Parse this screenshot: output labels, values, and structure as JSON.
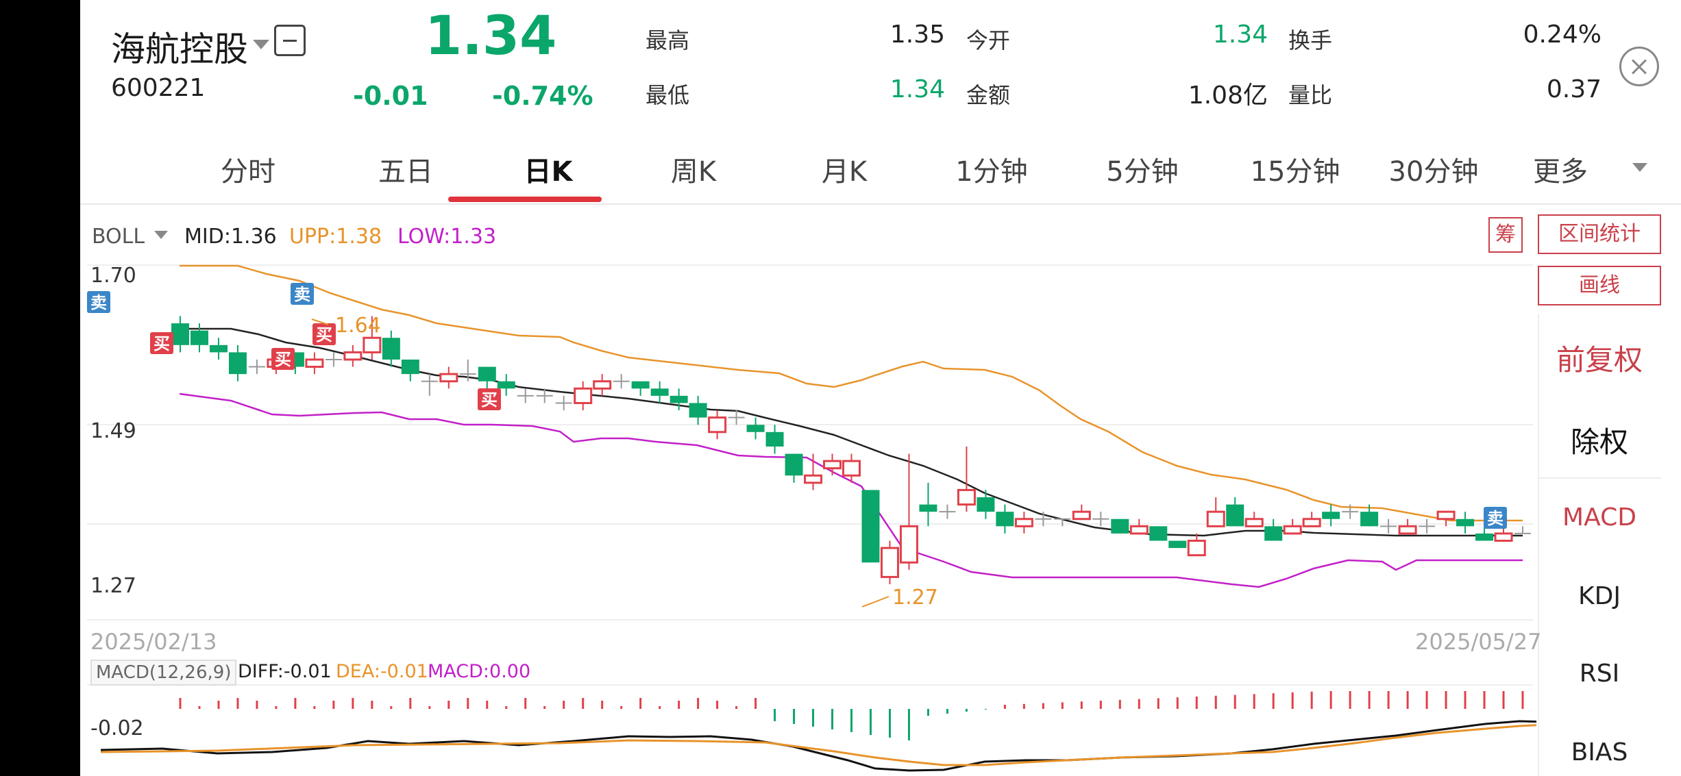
{
  "header": {
    "name": "海航控股",
    "code": "600221",
    "price": "1.34",
    "change": "-0.01",
    "change_pct": "-0.74%",
    "quotes": [
      {
        "label": "最高",
        "value": "1.35"
      },
      {
        "label": "今开",
        "value": "1.34"
      },
      {
        "label": "换手",
        "value": "0.24%"
      },
      {
        "label": "最低",
        "value": "1.34"
      },
      {
        "label": "金额",
        "value": "1.08亿"
      },
      {
        "label": "量比",
        "value": "0.37"
      }
    ]
  },
  "tabs": [
    "分时",
    "五日",
    "日K",
    "周K",
    "月K",
    "1分钟",
    "5分钟",
    "15分钟",
    "30分钟",
    "更多"
  ],
  "active_tab": "日K",
  "boll": {
    "name": "BOLL",
    "mid": "MID:1.36",
    "upp": "UPP:1.38",
    "low": "LOW:1.33",
    "colors": {
      "mid": "#222222",
      "upp": "#e8932a",
      "low": "#c21fc8"
    }
  },
  "axis": {
    "price_labels": [
      "1.70",
      "1.49",
      "1.27"
    ],
    "start_date": "2025/02/13",
    "end_date": "2025/05/27",
    "high_label": "1.64",
    "low_label": "1.27",
    "macd_label": "-0.02"
  },
  "macd": {
    "name": "MACD(12,26,9)",
    "diff": "DIFF:-0.01",
    "dea": "DEA:-0.01",
    "macd": "MACD:0.00"
  },
  "signals": {
    "buy": "买",
    "sell": "卖"
  },
  "right_panel": {
    "chip": "筹",
    "range_stats": "区间统计",
    "draw": "画线",
    "forward_adjust": "前复权",
    "ex_rights": "除权",
    "indicators": [
      "MACD",
      "KDJ",
      "RSI",
      "BIAS"
    ]
  },
  "colors": {
    "up": "#e0404a",
    "down": "#0ba66a",
    "accent": "#e0333c"
  }
}
